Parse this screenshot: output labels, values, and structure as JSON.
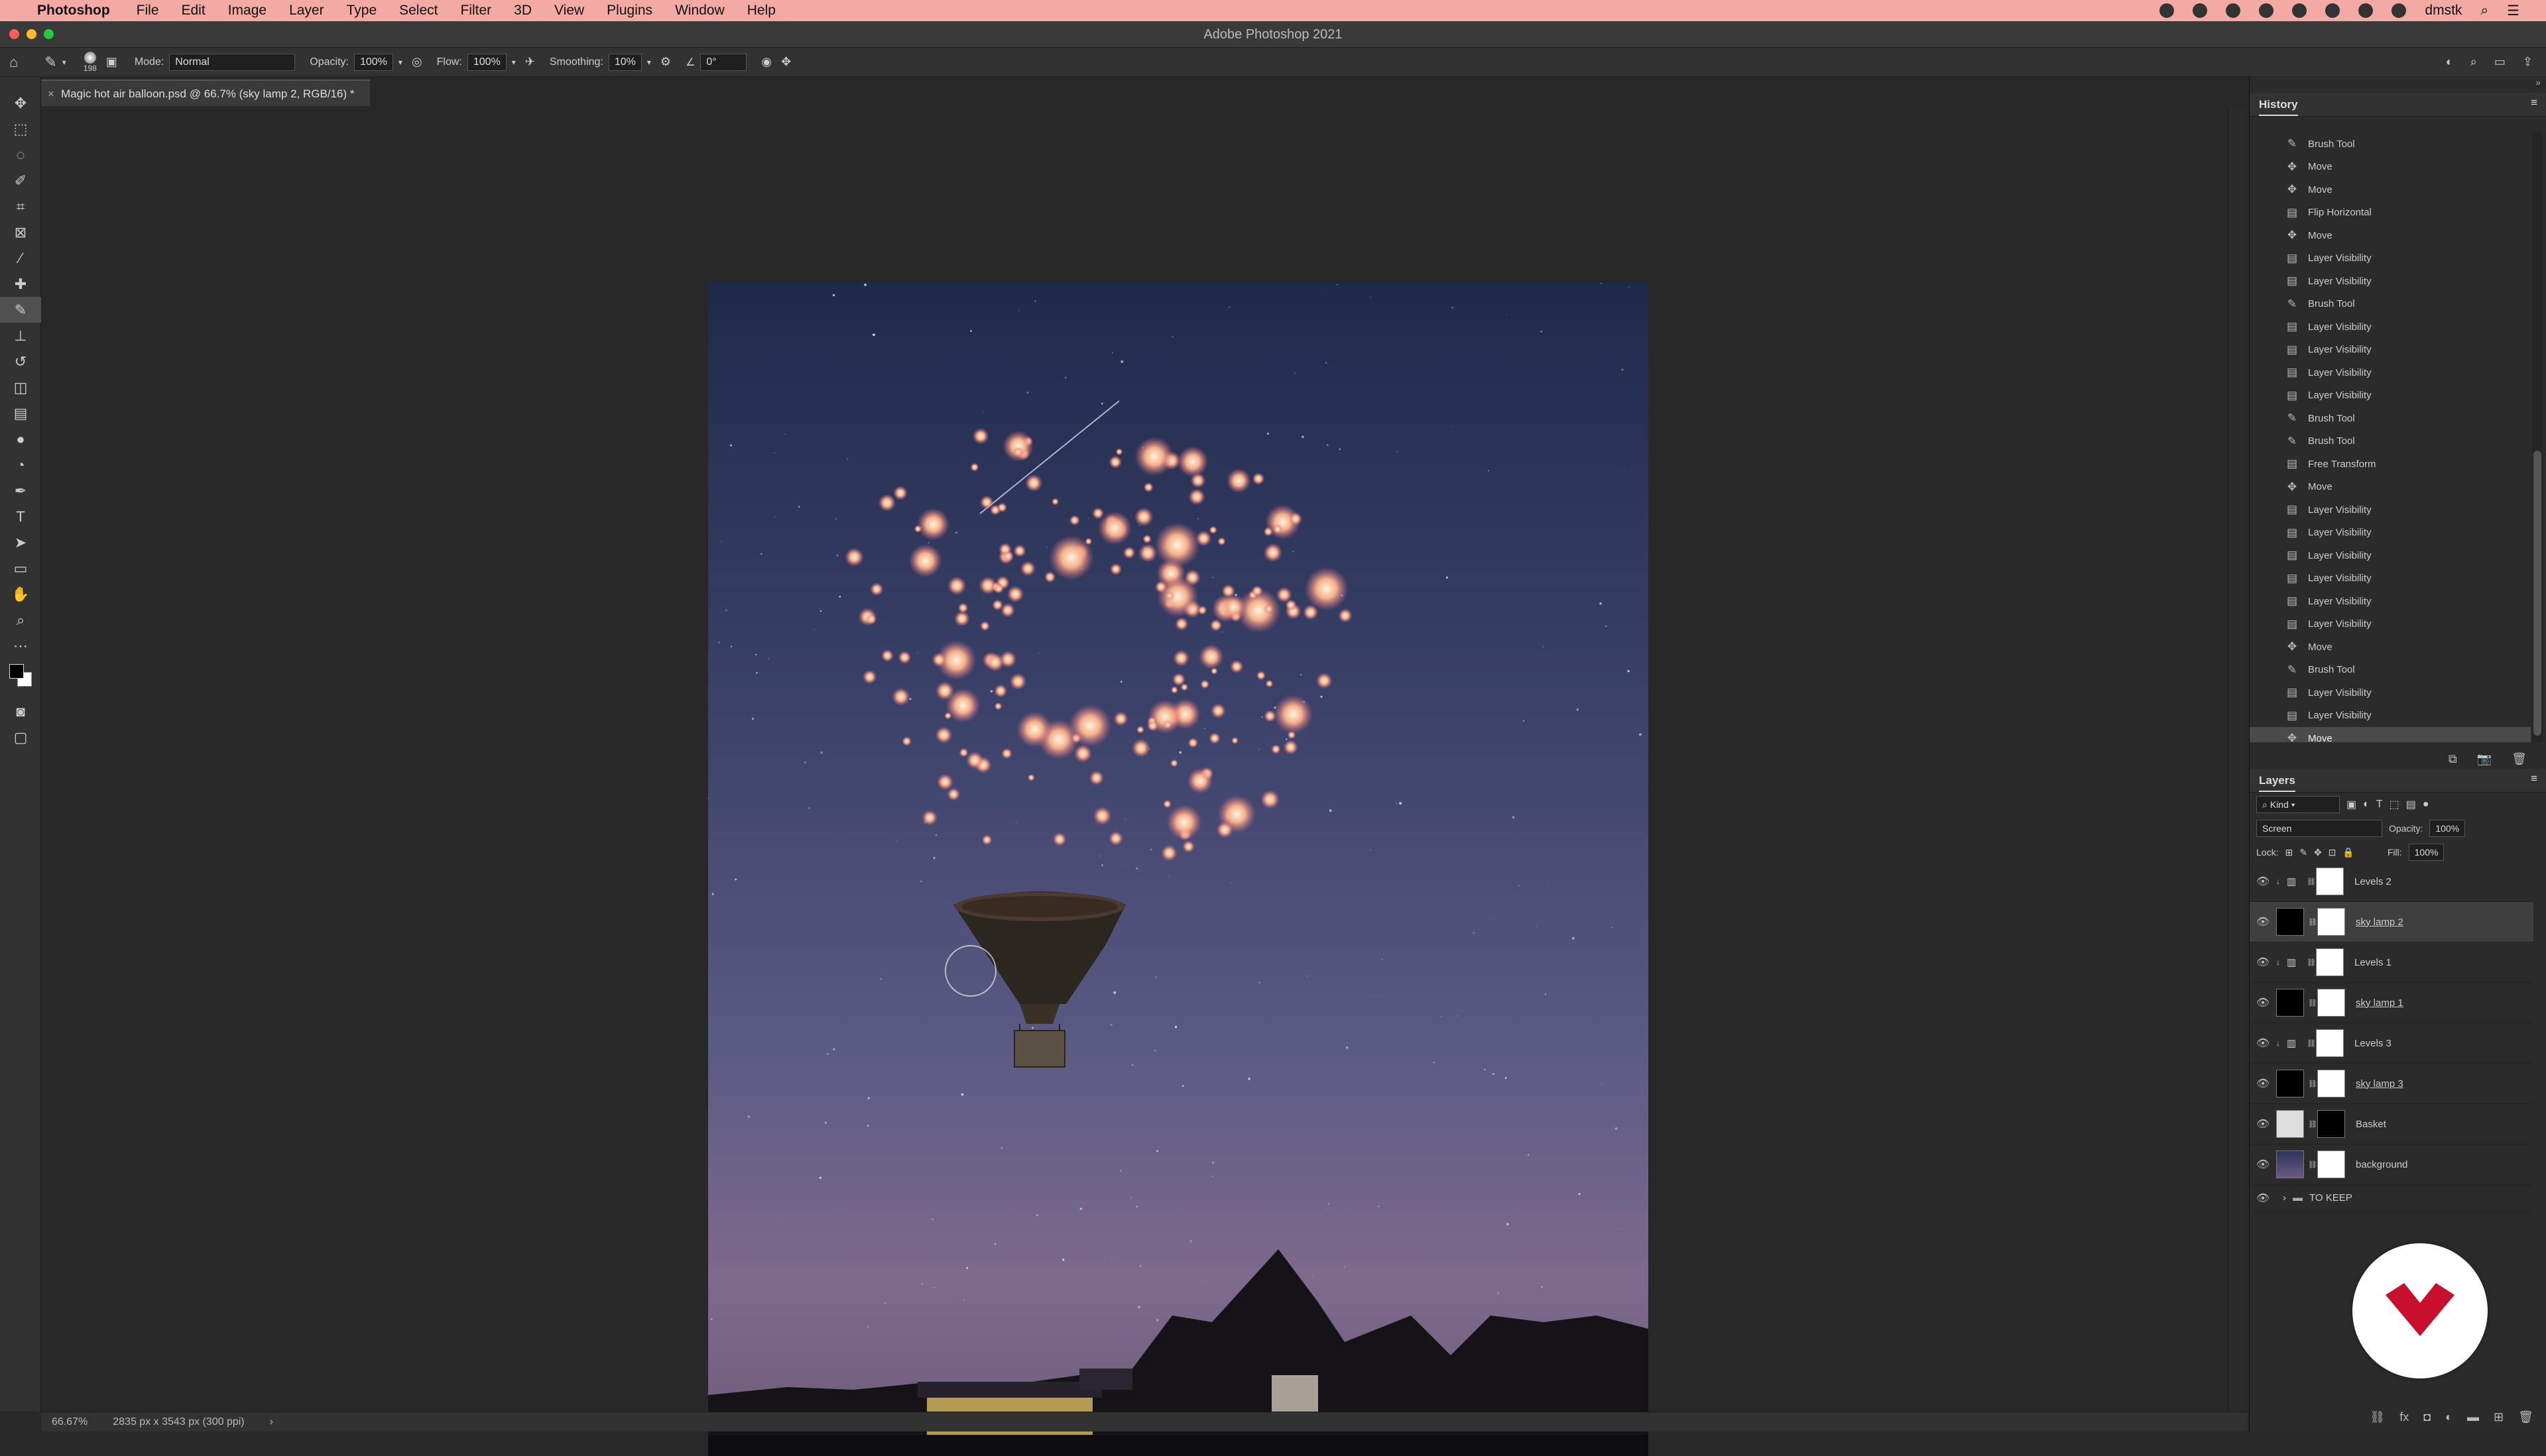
{
  "menubar": {
    "app": "Photoshop",
    "items": [
      "File",
      "Edit",
      "Image",
      "Layer",
      "Type",
      "Select",
      "Filter",
      "3D",
      "View",
      "Plugins",
      "Window",
      "Help"
    ],
    "user": "dmstk"
  },
  "window": {
    "title": "Adobe Photoshop 2021"
  },
  "options": {
    "brush_size": "198",
    "mode_label": "Mode:",
    "mode_value": "Normal",
    "opacity_label": "Opacity:",
    "opacity_value": "100%",
    "flow_label": "Flow:",
    "flow_value": "100%",
    "smoothing_label": "Smoothing:",
    "smoothing_value": "10%",
    "angle_value": "0°"
  },
  "document": {
    "tab_title": "Magic hot air balloon.psd @ 66.7% (sky lamp 2, RGB/16) *"
  },
  "status": {
    "zoom": "66.67%",
    "doc_info": "2835 px x 3543 px (300 ppi)"
  },
  "history": {
    "title": "History",
    "items": [
      {
        "label": "Brush Tool",
        "icon": "brush-icon"
      },
      {
        "label": "Move",
        "icon": "move-icon"
      },
      {
        "label": "Move",
        "icon": "move-icon"
      },
      {
        "label": "Flip Horizontal",
        "icon": "layer-icon"
      },
      {
        "label": "Move",
        "icon": "move-icon"
      },
      {
        "label": "Layer Visibility",
        "icon": "layer-icon"
      },
      {
        "label": "Layer Visibility",
        "icon": "layer-icon"
      },
      {
        "label": "Brush Tool",
        "icon": "brush-icon"
      },
      {
        "label": "Layer Visibility",
        "icon": "layer-icon"
      },
      {
        "label": "Layer Visibility",
        "icon": "layer-icon"
      },
      {
        "label": "Layer Visibility",
        "icon": "layer-icon"
      },
      {
        "label": "Layer Visibility",
        "icon": "layer-icon"
      },
      {
        "label": "Brush Tool",
        "icon": "brush-icon"
      },
      {
        "label": "Brush Tool",
        "icon": "brush-icon"
      },
      {
        "label": "Free Transform",
        "icon": "layer-icon"
      },
      {
        "label": "Move",
        "icon": "move-icon"
      },
      {
        "label": "Layer Visibility",
        "icon": "layer-icon"
      },
      {
        "label": "Layer Visibility",
        "icon": "layer-icon"
      },
      {
        "label": "Layer Visibility",
        "icon": "layer-icon"
      },
      {
        "label": "Layer Visibility",
        "icon": "layer-icon"
      },
      {
        "label": "Layer Visibility",
        "icon": "layer-icon"
      },
      {
        "label": "Layer Visibility",
        "icon": "layer-icon"
      },
      {
        "label": "Move",
        "icon": "move-icon"
      },
      {
        "label": "Brush Tool",
        "icon": "brush-icon"
      },
      {
        "label": "Layer Visibility",
        "icon": "layer-icon"
      },
      {
        "label": "Layer Visibility",
        "icon": "layer-icon"
      },
      {
        "label": "Move",
        "icon": "move-icon",
        "selected": true
      }
    ]
  },
  "layers": {
    "title": "Layers",
    "filter_kind": "Kind",
    "blend_mode": "Screen",
    "opacity_label": "Opacity:",
    "opacity_value": "100%",
    "lock_label": "Lock:",
    "fill_label": "Fill:",
    "fill_value": "100%",
    "items": [
      {
        "name": "Levels 2",
        "type": "adjustment"
      },
      {
        "name": "sky lamp 2",
        "type": "pixel",
        "selected": true
      },
      {
        "name": "Levels 1",
        "type": "adjustment"
      },
      {
        "name": "sky lamp 1",
        "type": "pixel"
      },
      {
        "name": "Levels 3",
        "type": "adjustment"
      },
      {
        "name": "sky lamp 3",
        "type": "pixel"
      },
      {
        "name": "Basket",
        "type": "pixel"
      },
      {
        "name": "background",
        "type": "pixel"
      },
      {
        "name": "TO KEEP",
        "type": "group"
      }
    ]
  },
  "colors": {
    "menubar_bg": "#f3a9a4",
    "accent_red": "#c8102e"
  }
}
